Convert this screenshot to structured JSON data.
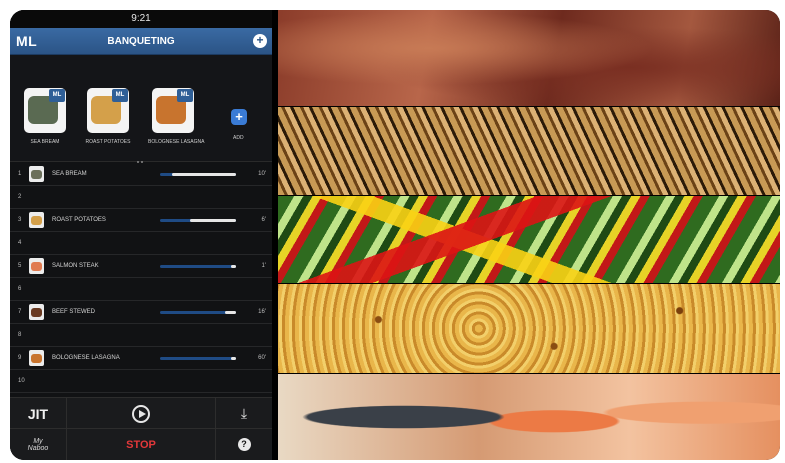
{
  "status_bar": {
    "time": "9:21"
  },
  "nav": {
    "logo": "ML",
    "title": "BANQUETING",
    "add_icon": "plus-circle-icon"
  },
  "carousel": {
    "badge": "ML",
    "items": [
      {
        "label": "SEA BREAM",
        "color": "#5a6a52"
      },
      {
        "label": "ROAST POTATOES",
        "color": "#d4a04a"
      },
      {
        "label": "BOLOGNESE LASAGNA",
        "color": "#c8742e"
      }
    ],
    "add_label": "ADD"
  },
  "slots": [
    {
      "num": "1",
      "name": "SEA BREAM",
      "time": "10'",
      "progress": 0.84,
      "color": "#6b6f5a"
    },
    {
      "num": "2",
      "name": "",
      "time": ""
    },
    {
      "num": "3",
      "name": "ROAST POTATOES",
      "time": "6'",
      "progress": 0.6,
      "color": "#d4a04a"
    },
    {
      "num": "4",
      "name": "",
      "time": ""
    },
    {
      "num": "5",
      "name": "SALMON STEAK",
      "time": "1'",
      "progress": 0.06,
      "color": "#e07a50"
    },
    {
      "num": "6",
      "name": "",
      "time": ""
    },
    {
      "num": "7",
      "name": "BEEF STEWED",
      "time": "16'",
      "progress": 0.15,
      "color": "#6a3a22"
    },
    {
      "num": "8",
      "name": "",
      "time": ""
    },
    {
      "num": "9",
      "name": "BOLOGNESE LASAGNA",
      "time": "60'",
      "progress": 0.06,
      "color": "#c8742e"
    },
    {
      "num": "10",
      "name": "",
      "time": ""
    }
  ],
  "toolbar": {
    "jit": "JIT",
    "play_icon": "play-circle-icon",
    "download_icon": "download-icon",
    "brand_line1": "My",
    "brand_line2": "Naboo",
    "stop": "STOP",
    "help": "?"
  }
}
